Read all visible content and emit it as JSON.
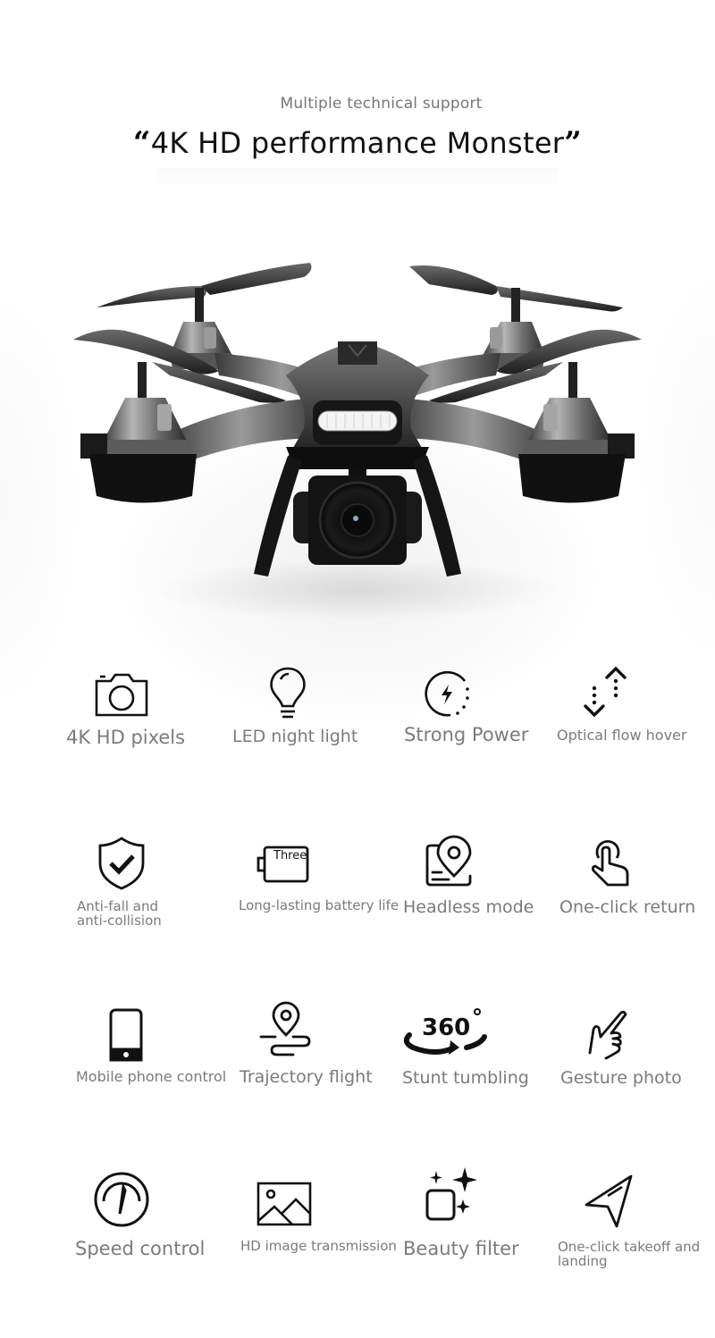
{
  "header": {
    "subtitle": "Multiple technical support",
    "open_quote": "“",
    "title": "4K HD performance Monster",
    "close_quote": "”"
  },
  "product": {
    "image_name": "quadcopter-drone-with-camera"
  },
  "features": [
    {
      "label": "4K HD pixels",
      "icon": "camera-icon"
    },
    {
      "label": "LED night light",
      "icon": "lightbulb-icon"
    },
    {
      "label": "Strong Power",
      "icon": "power-charge-icon"
    },
    {
      "label": "Optical flow hover",
      "icon": "up-down-arrows-icon"
    },
    {
      "label": "Anti-fall and anti-collision",
      "icon": "shield-check-icon"
    },
    {
      "label": "Long-lasting battery life",
      "icon": "battery-icon",
      "icon_text": "Three"
    },
    {
      "label": "Headless mode",
      "icon": "location-card-icon"
    },
    {
      "label": "One-click return",
      "icon": "tap-finger-icon"
    },
    {
      "label": "Mobile phone control",
      "icon": "smartphone-icon"
    },
    {
      "label": "Trajectory flight",
      "icon": "route-pin-icon"
    },
    {
      "label": "Stunt tumbling",
      "icon": "rotate-360-icon",
      "icon_text": "360°"
    },
    {
      "label": "Gesture photo",
      "icon": "gesture-hand-icon"
    },
    {
      "label": "Speed control",
      "icon": "speedometer-icon"
    },
    {
      "label": "HD image transmission",
      "icon": "image-icon"
    },
    {
      "label": "Beauty filter",
      "icon": "sparkle-square-icon"
    },
    {
      "label": "One-click takeoff and landing",
      "icon": "send-arrow-icon"
    }
  ]
}
